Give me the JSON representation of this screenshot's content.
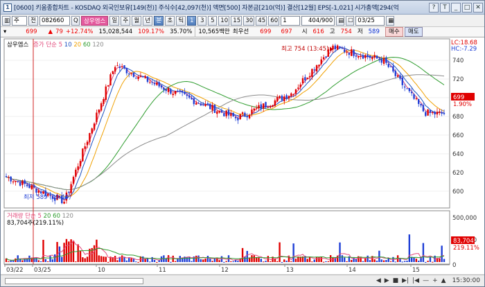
{
  "window": {
    "title": "[0600] 키움종합차트 - KOSDAQ 외국인보유[149(천)] 주식수[42,097(천)] 액면[500] 자본금[210(억)] 결산[12월] EPS[-1,021] 시가총액[294(억",
    "app_icon": "1",
    "buttons": [
      "?",
      "T",
      "_",
      "□",
      "✕"
    ]
  },
  "toolbar": {
    "market_select": "주",
    "exchange_btn": "전",
    "stock_code": "082660",
    "stock_name": "삼우엠스",
    "period_buttons": [
      "일",
      "주",
      "월",
      "년",
      "분",
      "초",
      "틱"
    ],
    "selected_period": "분",
    "minute_options": [
      "1",
      "3",
      "5",
      "10",
      "15",
      "30",
      "45",
      "60"
    ],
    "selected_minute": "1",
    "count_select": "1",
    "count_display": "404/900",
    "date": "03/25"
  },
  "quote": {
    "price": "699",
    "change": "79",
    "change_pct": "+12.74%",
    "volume": "15,028,544",
    "volume_ratio": "109.17%",
    "turnover": "35.70%",
    "trade_value": "10,565백만",
    "best_bid_label": "최우선",
    "best_ask": "699",
    "best_bid": "697",
    "open_label": "시",
    "open": "616",
    "high_label": "고",
    "high": "754",
    "low_label": "저",
    "low": "589",
    "buy_label": "매수",
    "sell_label": "매도"
  },
  "price_panel": {
    "name": "삼우엠스",
    "ma_label": "증가 단순",
    "ma_periods": [
      "5",
      "10",
      "20",
      "60",
      "120"
    ],
    "lc": "LC:18.68",
    "hc": "HC:-7.29",
    "high_annotation": "최고 754 (13:45)",
    "low_annotation": "최저 589 (09:40)",
    "last_price_tag": "699",
    "last_pct_tag": "1.90%",
    "yticks": [
      "740",
      "720",
      "700",
      "680",
      "660",
      "640",
      "620",
      "600"
    ]
  },
  "volume_panel": {
    "name": "거래량",
    "ma_label": "단순",
    "ma_periods": [
      "5",
      "20",
      "60",
      "120"
    ],
    "last_info": "83,704주(219.11%)",
    "yticks": [
      "500,000",
      "250,000",
      "0"
    ],
    "last_tag": "83,704",
    "last_pct_tag": "219.11%"
  },
  "xaxis": {
    "labels": [
      "03/22",
      "03/25",
      "10",
      "11",
      "12",
      "13",
      "14",
      "15"
    ],
    "time_display": "15:30:00"
  },
  "navigation": [
    "◀",
    "▶",
    "■",
    "▶|",
    "|◀",
    "—",
    "+",
    "▲"
  ],
  "colors": {
    "up": "#e00000",
    "down": "#1f3fd6",
    "ma5": "#e2487a",
    "ma10": "#1a50c0",
    "ma20": "#f0a000",
    "ma60": "#2d9c2d",
    "ma120": "#8a8a8a",
    "volume_ma5": "#e2487a",
    "volume_ma20": "#2d9c2d"
  },
  "chart_data": {
    "type": "candlestick",
    "symbol": "삼우엠스",
    "interval": "1분",
    "y_range": [
      589,
      754
    ],
    "high": 754,
    "low": 589,
    "key_points": [
      {
        "x": "03/22",
        "y": 615
      },
      {
        "x": "03/25 09:40",
        "y": 589
      },
      {
        "x": "10",
        "y": 735
      },
      {
        "x": "11",
        "y": 712
      },
      {
        "x": "12",
        "y": 678
      },
      {
        "x": "13",
        "y": 705
      },
      {
        "x": "13:45",
        "y": 754
      },
      {
        "x": "14",
        "y": 740
      },
      {
        "x": "15",
        "y": 684
      },
      {
        "x": "15:30",
        "y": 683
      }
    ]
  }
}
